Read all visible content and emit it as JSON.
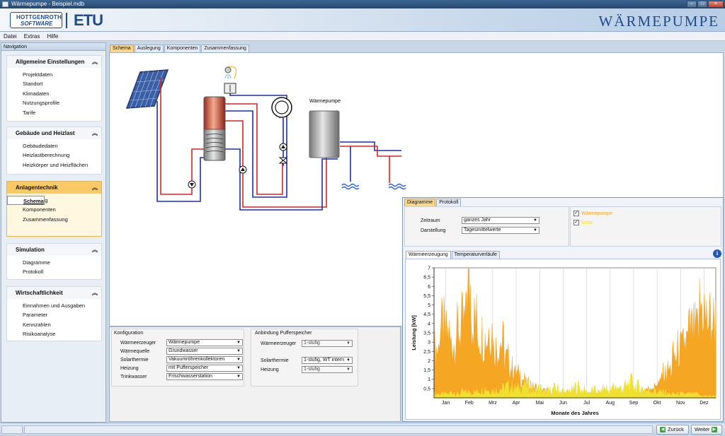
{
  "window": {
    "title": "Wärmepumpe - Beispiel.mdb"
  },
  "banner": {
    "logo_line1": "HOTTGENROTH",
    "logo_line2": "SOFTWARE",
    "product": "ETU",
    "app_name": "WÄRMEPUMPE"
  },
  "menu": [
    "Datei",
    "Extras",
    "Hilfe"
  ],
  "nav": {
    "header": "Navigation",
    "groups": [
      {
        "title": "Allgemeine Einstellungen",
        "items": [
          "Projektdaten",
          "Standort",
          "Klimadaten",
          "Nutzungsprofile",
          "Tarife"
        ]
      },
      {
        "title": "Gebäude und Heizlast",
        "items": [
          "Gebäudedaten",
          "Heizlastberechnung",
          "Heizkörper und Heizflächen"
        ]
      },
      {
        "title": "Anlagentechnik",
        "items": [
          "Schema",
          "Auslegung",
          "Komponenten",
          "Zusammenfassung"
        ]
      },
      {
        "title": "Simulation",
        "items": [
          "Diagramme",
          "Protokoll"
        ]
      },
      {
        "title": "Wirtschaftlichkeit",
        "items": [
          "Einnahmen und Ausgaben",
          "Parameter",
          "Kennzahlen",
          "Risikoanalyse"
        ]
      }
    ]
  },
  "main_tabs": [
    "Schema",
    "Auslegung",
    "Komponenten",
    "Zusammenfassung"
  ],
  "schema": {
    "heatpump_label": "Wärmepumpe"
  },
  "config": {
    "title": "Konfiguration",
    "rows": [
      {
        "label": "Wärmeerzeuger",
        "value": "Wärmepumpe"
      },
      {
        "label": "Wärmequelle",
        "value": "Grundwasser"
      },
      {
        "label": "Solarthermie",
        "value": "Vakuumröhrenkollektoren"
      },
      {
        "label": "Heizung",
        "value": "mit Pufferspeicher"
      },
      {
        "label": "Trinkwasser",
        "value": "Frischwasserstation"
      }
    ]
  },
  "buffer": {
    "title": "Anbindung Pufferspeicher",
    "rows": [
      {
        "label": "Wärmeerzeuger",
        "value": "1-stufig"
      },
      {
        "label": "Solarthermie",
        "value": "1-stufig, WT intern"
      },
      {
        "label": "Heizung",
        "value": "1-stufig"
      }
    ]
  },
  "diagram": {
    "tabs": [
      "Diagramme",
      "Protokoll"
    ],
    "zeitraum_label": "Zeitraum",
    "zeitraum_value": "ganzes Jahr",
    "darstellung_label": "Darstellung",
    "darstellung_value": "Tagesmittelwerte",
    "legend": [
      {
        "label": "Wärmepumpe",
        "color": "#f5a623",
        "checked": true
      },
      {
        "label": "Solar",
        "color": "#f0e030",
        "checked": true
      }
    ],
    "subtabs": [
      "Wärmeerzeugung",
      "Temperaturverläufe"
    ]
  },
  "chart_data": {
    "type": "area",
    "xlabel": "Monate des Jahres",
    "ylabel": "Leistung [kW]",
    "ylim": [
      0,
      7
    ],
    "yticks": [
      "0,5",
      "1",
      "1,5",
      "2",
      "2,5",
      "3",
      "3,5",
      "4",
      "4,5",
      "5",
      "5,5",
      "6",
      "6,5",
      "7"
    ],
    "categories": [
      "Jan",
      "Feb",
      "Mrz",
      "Apr",
      "Mai",
      "Jun",
      "Jul",
      "Aug",
      "Sep",
      "Okt",
      "Nov",
      "Dez"
    ],
    "grid": true,
    "series": [
      {
        "name": "Wärmepumpe",
        "color": "#f5a623",
        "weekly_values": [
          2.6,
          3.8,
          3.4,
          2.9,
          3.6,
          4.0,
          6.0,
          4.2,
          3.4,
          3.2,
          3.7,
          2.7,
          3.0,
          2.1,
          1.6,
          1.3,
          1.0,
          0.8,
          0.6,
          0.5,
          0.4,
          0.3,
          0.3,
          0.3,
          0.3,
          0.3,
          0.3,
          0.3,
          0.3,
          0.3,
          0.3,
          0.3,
          0.3,
          0.3,
          0.3,
          0.3,
          0.3,
          0.4,
          0.4,
          0.5,
          0.6,
          0.8,
          1.3,
          1.5,
          2.2,
          2.6,
          3.0,
          3.6,
          3.6,
          4.9,
          4.2,
          4.1
        ]
      },
      {
        "name": "Solar",
        "color": "#f0e030",
        "weekly_values": [
          0.2,
          0.2,
          0.2,
          0.3,
          0.2,
          0.3,
          0.3,
          0.3,
          0.4,
          0.5,
          0.4,
          0.4,
          0.5,
          0.6,
          0.6,
          0.5,
          0.7,
          0.6,
          0.4,
          0.5,
          0.3,
          0.4,
          0.5,
          0.4,
          0.3,
          0.4,
          0.6,
          0.4,
          0.3,
          0.4,
          0.3,
          0.5,
          0.4,
          0.6,
          0.5,
          0.6,
          0.8,
          0.6,
          0.5,
          0.4,
          0.4,
          0.3,
          0.3,
          0.2,
          0.2,
          0.2,
          0.2,
          0.2,
          0.2,
          0.1,
          0.1,
          0.1
        ]
      }
    ]
  },
  "footer": {
    "back": "Zurück",
    "next": "Weiter"
  }
}
